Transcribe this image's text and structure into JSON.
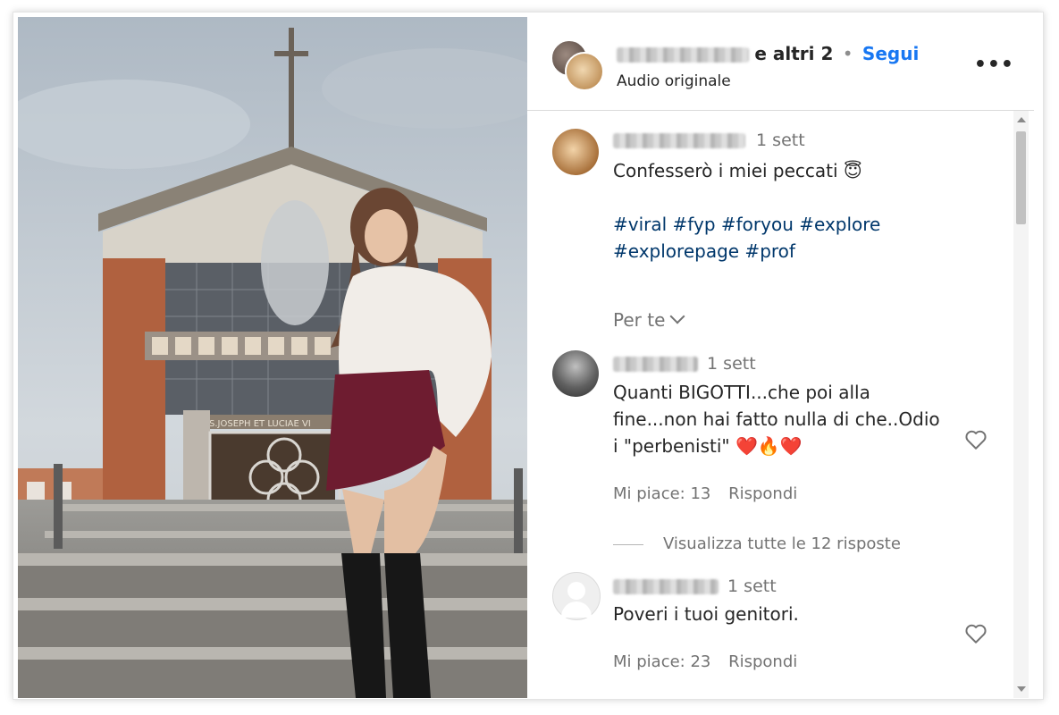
{
  "post": {
    "header": {
      "co_authors": "e altri 2",
      "separator": "•",
      "follow_label": "Segui",
      "audio": "Audio originale",
      "more_label": "•••"
    },
    "caption": {
      "time": "1 sett",
      "text": "Confesserò i miei peccati 😇",
      "hashtags_line1": "#viral #fyp #foryou #explore",
      "hashtags_line2": "#explorepage #prof",
      "translation_toggle": "Per te"
    },
    "comments": [
      {
        "time": "1 sett",
        "text_line1": "Quanti BIGOTTI...che poi alla",
        "text_line2": "fine...non hai fatto nulla di che..Odio",
        "text_line3": "i \"perbenisti\" ❤️🔥❤️",
        "likes": "Mi piace: 13",
        "reply_label": "Rispondi",
        "view_replies": "Visualizza tutte le 12 risposte"
      },
      {
        "time": "1 sett",
        "text_line1": "Poveri i tuoi genitori.",
        "likes": "Mi piace: 23",
        "reply_label": "Rispondi"
      }
    ]
  },
  "media": {
    "building_inscription": "S.JOSEPH ET LUCIAE VI"
  },
  "colors": {
    "accent": "#1877f2",
    "hashtag": "#00376b",
    "muted": "#737373"
  }
}
